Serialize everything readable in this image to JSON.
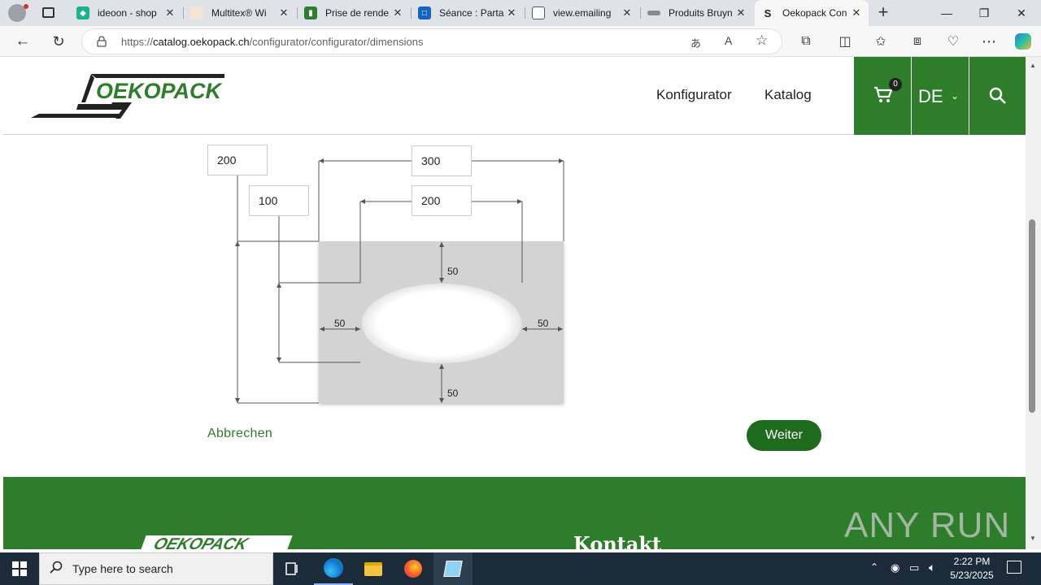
{
  "browser": {
    "tabs": [
      {
        "label": "ideoon - shop",
        "active": false
      },
      {
        "label": "Multitex® Wi",
        "active": false
      },
      {
        "label": "Prise de rende",
        "active": false
      },
      {
        "label": "Séance : Parta",
        "active": false
      },
      {
        "label": "view.emailing",
        "active": false
      },
      {
        "label": "Produits Bruyn",
        "active": false
      },
      {
        "label": "Oekopack Con",
        "active": true
      }
    ],
    "url_prefix": "https://",
    "url_host": "catalog.oekopack.ch",
    "url_path": "/configurator/configurator/dimensions"
  },
  "site": {
    "logo_text": "OEKOPACK",
    "nav": {
      "configurator": "Konfigurator",
      "catalog": "Katalog"
    },
    "cart_count": "0",
    "language": "DE"
  },
  "diagram": {
    "inputs": {
      "top_left": "200",
      "inner_left": "100",
      "outer_width": "300",
      "inner_width": "200"
    },
    "margins": {
      "top": "50",
      "left": "50",
      "right": "50",
      "bottom": "50"
    }
  },
  "actions": {
    "cancel": "Abbrechen",
    "next": "Weiter"
  },
  "footer": {
    "contact_heading": "Kontakt",
    "logo_text": "OEKOPACK"
  },
  "watermark": "ANY RUN",
  "taskbar": {
    "search_placeholder": "Type here to search",
    "time": "2:22 PM",
    "date": "5/23/2025"
  },
  "colors": {
    "brand_green": "#2e7d2a",
    "button_green": "#1e6b1e"
  }
}
